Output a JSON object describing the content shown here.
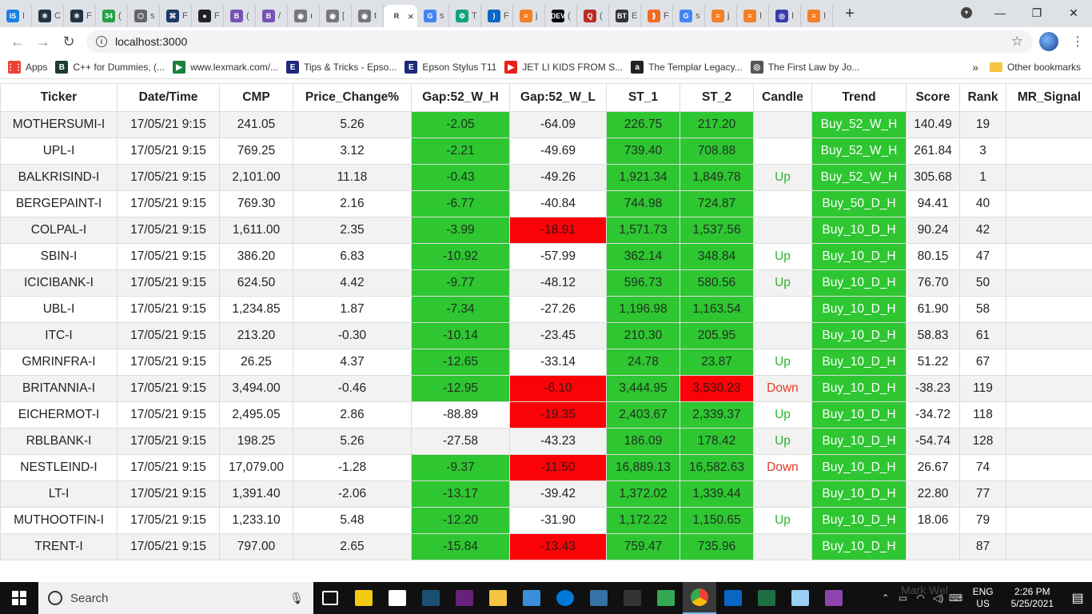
{
  "browser": {
    "tabs": [
      {
        "abbr": "IS",
        "color": "#1f7fe0",
        "label": "I"
      },
      {
        "abbr": "⚛",
        "color": "#20323f",
        "label": "C"
      },
      {
        "abbr": "⚛",
        "color": "#20323f",
        "label": "F"
      },
      {
        "abbr": "34",
        "color": "#25a244",
        "label": "("
      },
      {
        "abbr": "⬡",
        "color": "#666666",
        "label": "s"
      },
      {
        "abbr": "⌘",
        "color": "#1b3a66",
        "label": "F"
      },
      {
        "abbr": "●",
        "color": "#222222",
        "label": "F"
      },
      {
        "abbr": "B",
        "color": "#7952b3",
        "label": "("
      },
      {
        "abbr": "B",
        "color": "#7952b3",
        "label": "/"
      },
      {
        "abbr": "◉",
        "color": "#777777",
        "label": "ı"
      },
      {
        "abbr": "◉",
        "color": "#777777",
        "label": "["
      },
      {
        "abbr": "◉",
        "color": "#777777",
        "label": "t"
      },
      {
        "abbr": "R",
        "color": "#ffffff",
        "label": "",
        "active": true
      },
      {
        "abbr": "G",
        "color": "#4285f4",
        "label": "s"
      },
      {
        "abbr": "⚙",
        "color": "#10a37f",
        "label": "T"
      },
      {
        "abbr": "⟩",
        "color": "#0a66c2",
        "label": "F"
      },
      {
        "abbr": "≡",
        "color": "#f48024",
        "label": "j"
      },
      {
        "abbr": "DEV",
        "color": "#000000",
        "label": "("
      },
      {
        "abbr": "Q",
        "color": "#b92b27",
        "label": "("
      },
      {
        "abbr": "BT",
        "color": "#333333",
        "label": "E"
      },
      {
        "abbr": "⟫",
        "color": "#f16a22",
        "label": "F"
      },
      {
        "abbr": "G",
        "color": "#4285f4",
        "label": "s"
      },
      {
        "abbr": "≡",
        "color": "#f48024",
        "label": "j"
      },
      {
        "abbr": "≡",
        "color": "#f48024",
        "label": "I"
      },
      {
        "abbr": "◎",
        "color": "#3b3bb0",
        "label": "I"
      },
      {
        "abbr": "≡",
        "color": "#f48024",
        "label": "I"
      }
    ],
    "active_tab_close": "×",
    "new_tab": "+",
    "url": "localhost:3000",
    "window_controls": {
      "minimize": "—",
      "maximize": "❐",
      "close": "✕"
    }
  },
  "bookmarks": {
    "items": [
      {
        "icon": "apps-icon",
        "text": "Apps",
        "color": "#ea4335",
        "abbr": "⋮⋮"
      },
      {
        "icon": "bn-icon",
        "text": "C++ for Dummies, (...",
        "color": "#1c3d2d",
        "abbr": "B"
      },
      {
        "icon": "lexmark-icon",
        "text": "www.lexmark.com/...",
        "color": "#1a7f3c",
        "abbr": "▶"
      },
      {
        "icon": "epson-icon",
        "text": "Tips & Tricks - Epso...",
        "color": "#1f2a7a",
        "abbr": "E"
      },
      {
        "icon": "epson-icon",
        "text": "Epson Stylus T11",
        "color": "#1f2a7a",
        "abbr": "E"
      },
      {
        "icon": "youtube-icon",
        "text": "JET LI KIDS FROM S...",
        "color": "#e62117",
        "abbr": "▶"
      },
      {
        "icon": "amazon-icon",
        "text": "The Templar Legacy...",
        "color": "#222222",
        "abbr": "a"
      },
      {
        "icon": "book-icon",
        "text": "The First Law by Jo...",
        "color": "#555555",
        "abbr": "◎"
      }
    ],
    "overflow": "»",
    "other_bookmarks": "Other bookmarks"
  },
  "table": {
    "columns": [
      "Ticker",
      "Date/Time",
      "CMP",
      "Price_Change%",
      "Gap:52_W_H",
      "Gap:52_W_L",
      "ST_1",
      "ST_2",
      "Candle",
      "Trend",
      "Score",
      "Rank",
      "MR_Signal"
    ],
    "rows": [
      {
        "ticker": "MOTHERSUMI-I",
        "datetime": "17/05/21 9:15",
        "cmp": "241.05",
        "price_change": "5.26",
        "gap_h": "-2.05",
        "gap_l": "-64.09",
        "st1": "226.75",
        "st2": "217.20",
        "candle": "",
        "trend": "Buy_52_W_H",
        "score": "140.49",
        "rank": "19",
        "mr": "",
        "c_gap_h": "green",
        "c_gap_l": "",
        "c_st1": "green",
        "c_st2": "green"
      },
      {
        "ticker": "UPL-I",
        "datetime": "17/05/21 9:15",
        "cmp": "769.25",
        "price_change": "3.12",
        "gap_h": "-2.21",
        "gap_l": "-49.69",
        "st1": "739.40",
        "st2": "708.88",
        "candle": "",
        "trend": "Buy_52_W_H",
        "score": "261.84",
        "rank": "3",
        "mr": "",
        "c_gap_h": "green",
        "c_gap_l": "",
        "c_st1": "green",
        "c_st2": "green"
      },
      {
        "ticker": "BALKRISIND-I",
        "datetime": "17/05/21 9:15",
        "cmp": "2,101.00",
        "price_change": "11.18",
        "gap_h": "-0.43",
        "gap_l": "-49.26",
        "st1": "1,921.34",
        "st2": "1,849.78",
        "candle": "Up",
        "trend": "Buy_52_W_H",
        "score": "305.68",
        "rank": "1",
        "mr": "",
        "c_gap_h": "green",
        "c_gap_l": "",
        "c_st1": "green",
        "c_st2": "green"
      },
      {
        "ticker": "BERGEPAINT-I",
        "datetime": "17/05/21 9:15",
        "cmp": "769.30",
        "price_change": "2.16",
        "gap_h": "-6.77",
        "gap_l": "-40.84",
        "st1": "744.98",
        "st2": "724.87",
        "candle": "",
        "trend": "Buy_50_D_H",
        "score": "94.41",
        "rank": "40",
        "mr": "",
        "c_gap_h": "green",
        "c_gap_l": "",
        "c_st1": "green",
        "c_st2": "green"
      },
      {
        "ticker": "COLPAL-I",
        "datetime": "17/05/21 9:15",
        "cmp": "1,611.00",
        "price_change": "2.35",
        "gap_h": "-3.99",
        "gap_l": "-18.91",
        "st1": "1,571.73",
        "st2": "1,537.56",
        "candle": "",
        "trend": "Buy_10_D_H",
        "score": "90.24",
        "rank": "42",
        "mr": "",
        "c_gap_h": "green",
        "c_gap_l": "red",
        "c_st1": "green",
        "c_st2": "green"
      },
      {
        "ticker": "SBIN-I",
        "datetime": "17/05/21 9:15",
        "cmp": "386.20",
        "price_change": "6.83",
        "gap_h": "-10.92",
        "gap_l": "-57.99",
        "st1": "362.14",
        "st2": "348.84",
        "candle": "Up",
        "trend": "Buy_10_D_H",
        "score": "80.15",
        "rank": "47",
        "mr": "",
        "c_gap_h": "green",
        "c_gap_l": "",
        "c_st1": "green",
        "c_st2": "green"
      },
      {
        "ticker": "ICICIBANK-I",
        "datetime": "17/05/21 9:15",
        "cmp": "624.50",
        "price_change": "4.42",
        "gap_h": "-9.77",
        "gap_l": "-48.12",
        "st1": "596.73",
        "st2": "580.56",
        "candle": "Up",
        "trend": "Buy_10_D_H",
        "score": "76.70",
        "rank": "50",
        "mr": "",
        "c_gap_h": "green",
        "c_gap_l": "",
        "c_st1": "green",
        "c_st2": "green"
      },
      {
        "ticker": "UBL-I",
        "datetime": "17/05/21 9:15",
        "cmp": "1,234.85",
        "price_change": "1.87",
        "gap_h": "-7.34",
        "gap_l": "-27.26",
        "st1": "1,196.98",
        "st2": "1,163.54",
        "candle": "",
        "trend": "Buy_10_D_H",
        "score": "61.90",
        "rank": "58",
        "mr": "",
        "c_gap_h": "green",
        "c_gap_l": "",
        "c_st1": "green",
        "c_st2": "green"
      },
      {
        "ticker": "ITC-I",
        "datetime": "17/05/21 9:15",
        "cmp": "213.20",
        "price_change": "-0.30",
        "gap_h": "-10.14",
        "gap_l": "-23.45",
        "st1": "210.30",
        "st2": "205.95",
        "candle": "",
        "trend": "Buy_10_D_H",
        "score": "58.83",
        "rank": "61",
        "mr": "",
        "c_gap_h": "green",
        "c_gap_l": "",
        "c_st1": "green",
        "c_st2": "green"
      },
      {
        "ticker": "GMRINFRA-I",
        "datetime": "17/05/21 9:15",
        "cmp": "26.25",
        "price_change": "4.37",
        "gap_h": "-12.65",
        "gap_l": "-33.14",
        "st1": "24.78",
        "st2": "23.87",
        "candle": "Up",
        "trend": "Buy_10_D_H",
        "score": "51.22",
        "rank": "67",
        "mr": "",
        "c_gap_h": "green",
        "c_gap_l": "",
        "c_st1": "green",
        "c_st2": "green"
      },
      {
        "ticker": "BRITANNIA-I",
        "datetime": "17/05/21 9:15",
        "cmp": "3,494.00",
        "price_change": "-0.46",
        "gap_h": "-12.95",
        "gap_l": "-6.10",
        "st1": "3,444.95",
        "st2": "3,530.23",
        "candle": "Down",
        "trend": "Buy_10_D_H",
        "score": "-38.23",
        "rank": "119",
        "mr": "",
        "c_gap_h": "green",
        "c_gap_l": "red",
        "c_st1": "green",
        "c_st2": "red"
      },
      {
        "ticker": "EICHERMOT-I",
        "datetime": "17/05/21 9:15",
        "cmp": "2,495.05",
        "price_change": "2.86",
        "gap_h": "-88.89",
        "gap_l": "-19.35",
        "st1": "2,403.67",
        "st2": "2,339.37",
        "candle": "Up",
        "trend": "Buy_10_D_H",
        "score": "-34.72",
        "rank": "118",
        "mr": "",
        "c_gap_h": "",
        "c_gap_l": "red",
        "c_st1": "green",
        "c_st2": "green"
      },
      {
        "ticker": "RBLBANK-I",
        "datetime": "17/05/21 9:15",
        "cmp": "198.25",
        "price_change": "5.26",
        "gap_h": "-27.58",
        "gap_l": "-43.23",
        "st1": "186.09",
        "st2": "178.42",
        "candle": "Up",
        "trend": "Buy_10_D_H",
        "score": "-54.74",
        "rank": "128",
        "mr": "",
        "c_gap_h": "",
        "c_gap_l": "",
        "c_st1": "green",
        "c_st2": "green"
      },
      {
        "ticker": "NESTLEIND-I",
        "datetime": "17/05/21 9:15",
        "cmp": "17,079.00",
        "price_change": "-1.28",
        "gap_h": "-9.37",
        "gap_l": "-11.50",
        "st1": "16,889.13",
        "st2": "16,582.63",
        "candle": "Down",
        "trend": "Buy_10_D_H",
        "score": "26.67",
        "rank": "74",
        "mr": "",
        "c_gap_h": "green",
        "c_gap_l": "red",
        "c_st1": "green",
        "c_st2": "green"
      },
      {
        "ticker": "LT-I",
        "datetime": "17/05/21 9:15",
        "cmp": "1,391.40",
        "price_change": "-2.06",
        "gap_h": "-13.17",
        "gap_l": "-39.42",
        "st1": "1,372.02",
        "st2": "1,339.44",
        "candle": "",
        "trend": "Buy_10_D_H",
        "score": "22.80",
        "rank": "77",
        "mr": "",
        "c_gap_h": "green",
        "c_gap_l": "",
        "c_st1": "green",
        "c_st2": "green"
      },
      {
        "ticker": "MUTHOOTFIN-I",
        "datetime": "17/05/21 9:15",
        "cmp": "1,233.10",
        "price_change": "5.48",
        "gap_h": "-12.20",
        "gap_l": "-31.90",
        "st1": "1,172.22",
        "st2": "1,150.65",
        "candle": "Up",
        "trend": "Buy_10_D_H",
        "score": "18.06",
        "rank": "79",
        "mr": "",
        "c_gap_h": "green",
        "c_gap_l": "",
        "c_st1": "green",
        "c_st2": "green"
      },
      {
        "ticker": "TRENT-I",
        "datetime": "17/05/21 9:15",
        "cmp": "797.00",
        "price_change": "2.65",
        "gap_h": "-15.84",
        "gap_l": "-13.43",
        "st1": "759.47",
        "st2": "735.96",
        "candle": "",
        "trend": "Buy_10_D_H",
        "score": "",
        "rank": "87",
        "mr": "",
        "c_gap_h": "green",
        "c_gap_l": "red",
        "c_st1": "green",
        "c_st2": "green"
      }
    ]
  },
  "colors": {
    "green": "#2ec631",
    "red": "#fb0207",
    "candle_up": "#2bb52d",
    "candle_down": "#e33a2a"
  },
  "taskbar": {
    "search_placeholder": "Search",
    "apps": [
      {
        "name": "task-view-icon",
        "color": "#ffffff"
      },
      {
        "name": "store-icon",
        "color": "#f2c811"
      },
      {
        "name": "mail-icon",
        "color": "#ffffff"
      },
      {
        "name": "mysql-workbench-icon",
        "color": "#1b4f72"
      },
      {
        "name": "vs-icon",
        "color": "#68217a"
      },
      {
        "name": "file-explorer-icon",
        "color": "#f6c342"
      },
      {
        "name": "notepad-icon",
        "color": "#3b8ed8"
      },
      {
        "name": "edge-icon",
        "color": "#0078d7"
      },
      {
        "name": "python-icon",
        "color": "#3572a5"
      },
      {
        "name": "terminal-icon",
        "color": "#333333"
      },
      {
        "name": "maps-icon",
        "color": "#34a853"
      },
      {
        "name": "chrome-icon",
        "color": "#ea4335",
        "active": true
      },
      {
        "name": "vscode-icon",
        "color": "#0a66c2"
      },
      {
        "name": "excel-icon",
        "color": "#1d6f42"
      },
      {
        "name": "pen-icon",
        "color": "#9ad0f5"
      },
      {
        "name": "winrar-icon",
        "color": "#8e44ad"
      }
    ],
    "watermark": "Mark Wel",
    "language": {
      "line1": "ENG",
      "line2": "US"
    },
    "time": "2:26 PM",
    "date": "5/25/2021"
  }
}
